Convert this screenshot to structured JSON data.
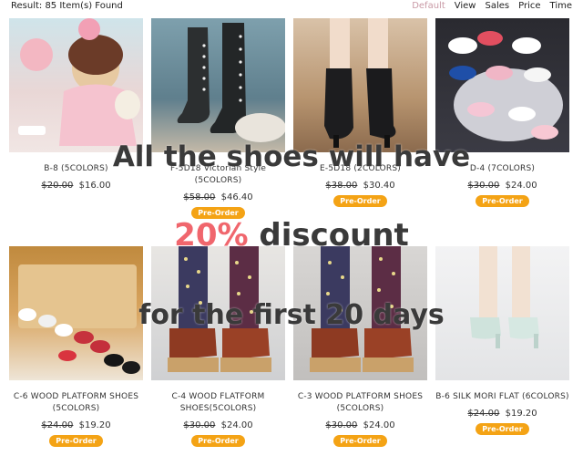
{
  "results": {
    "label": "Result: 85 Item(s) Found"
  },
  "sort": {
    "options": [
      "Default",
      "View",
      "Sales",
      "Price",
      "Time"
    ],
    "active": "Default",
    "active_color": "#c99aa6"
  },
  "products": [
    {
      "name": "B-8 (5COLORS)",
      "old_price": "$20.00",
      "new_price": "$16.00",
      "badge": ""
    },
    {
      "name": "F-5D18 Victorian Style (5COLORS)",
      "old_price": "$58.00",
      "new_price": "$46.40",
      "badge": "Pre-Order"
    },
    {
      "name": "E-5D18 (2COLORS)",
      "old_price": "$38.00",
      "new_price": "$30.40",
      "badge": "Pre-Order"
    },
    {
      "name": "D-4 (7COLORS)",
      "old_price": "$30.00",
      "new_price": "$24.00",
      "badge": "Pre-Order"
    },
    {
      "name": "C-6 WOOD PLATFORM SHOES (5COLORS)",
      "old_price": "$24.00",
      "new_price": "$19.20",
      "badge": "Pre-Order"
    },
    {
      "name": "C-4 WOOD FLATFORM SHOES(5COLORS)",
      "old_price": "$30.00",
      "new_price": "$24.00",
      "badge": "Pre-Order"
    },
    {
      "name": "C-3 WOOD PLATFORM SHOES (5COLORS)",
      "old_price": "$30.00",
      "new_price": "$24.00",
      "badge": "Pre-Order"
    },
    {
      "name": "B-6 SILK MORI FLAT (6COLORS)",
      "old_price": "$24.00",
      "new_price": "$19.20",
      "badge": "Pre-Order"
    }
  ],
  "promo": {
    "line1": "All the shoes will have",
    "line2_percent": "20%",
    "line2_rest": " discount",
    "line3": "for the first 20 days",
    "percent_color": "#f0666d",
    "text_color": "#3a3a3a"
  },
  "colors": {
    "badge": "#f4a315"
  }
}
